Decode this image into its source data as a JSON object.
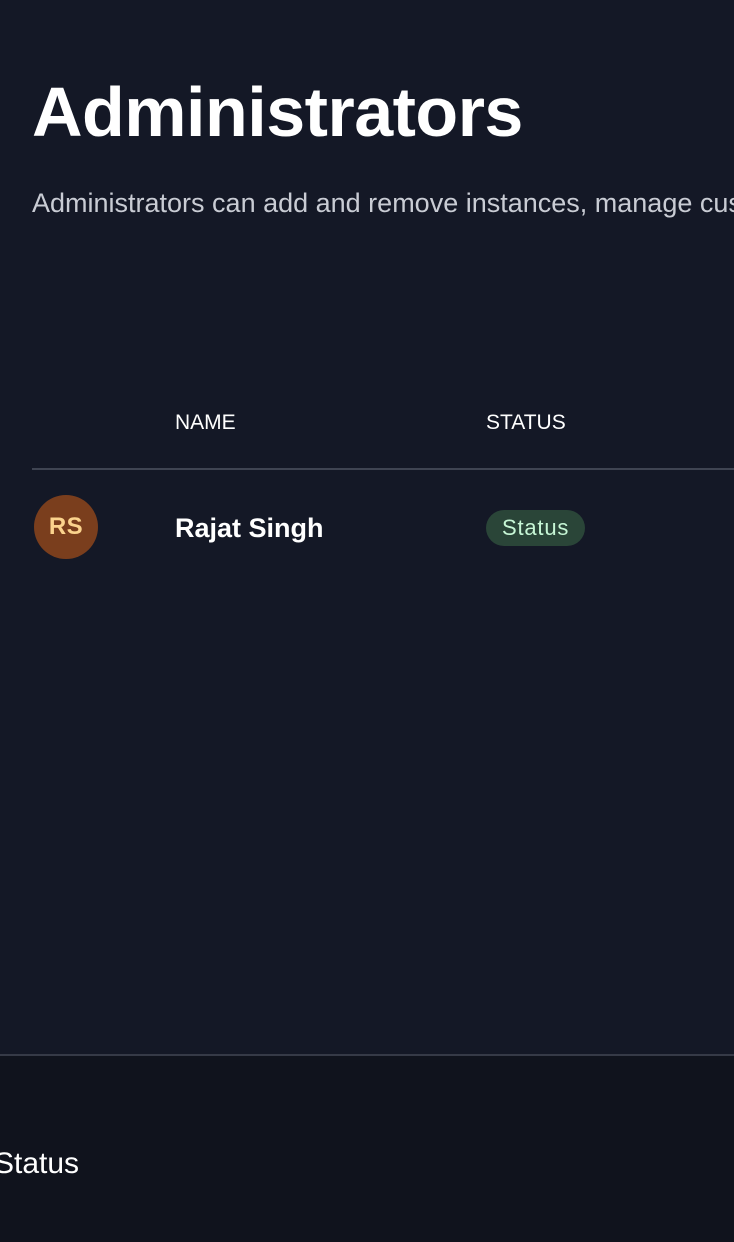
{
  "header": {
    "title": "Administrators",
    "description": "Administrators can add and remove instances, manage cus"
  },
  "table": {
    "columns": [
      "NAME",
      "STATUS"
    ],
    "rows": [
      {
        "initials": "RS",
        "name": "Rajat Singh",
        "status": "Status"
      }
    ]
  },
  "footer": {
    "status_label": "Status"
  },
  "colors": {
    "background": "#141826",
    "footer_background": "#10131d",
    "avatar_background": "#7a3e1d",
    "avatar_text": "#fbd38d",
    "badge_background": "#2a4538",
    "badge_text": "#c6f6d5",
    "divider": "#3f4452"
  }
}
